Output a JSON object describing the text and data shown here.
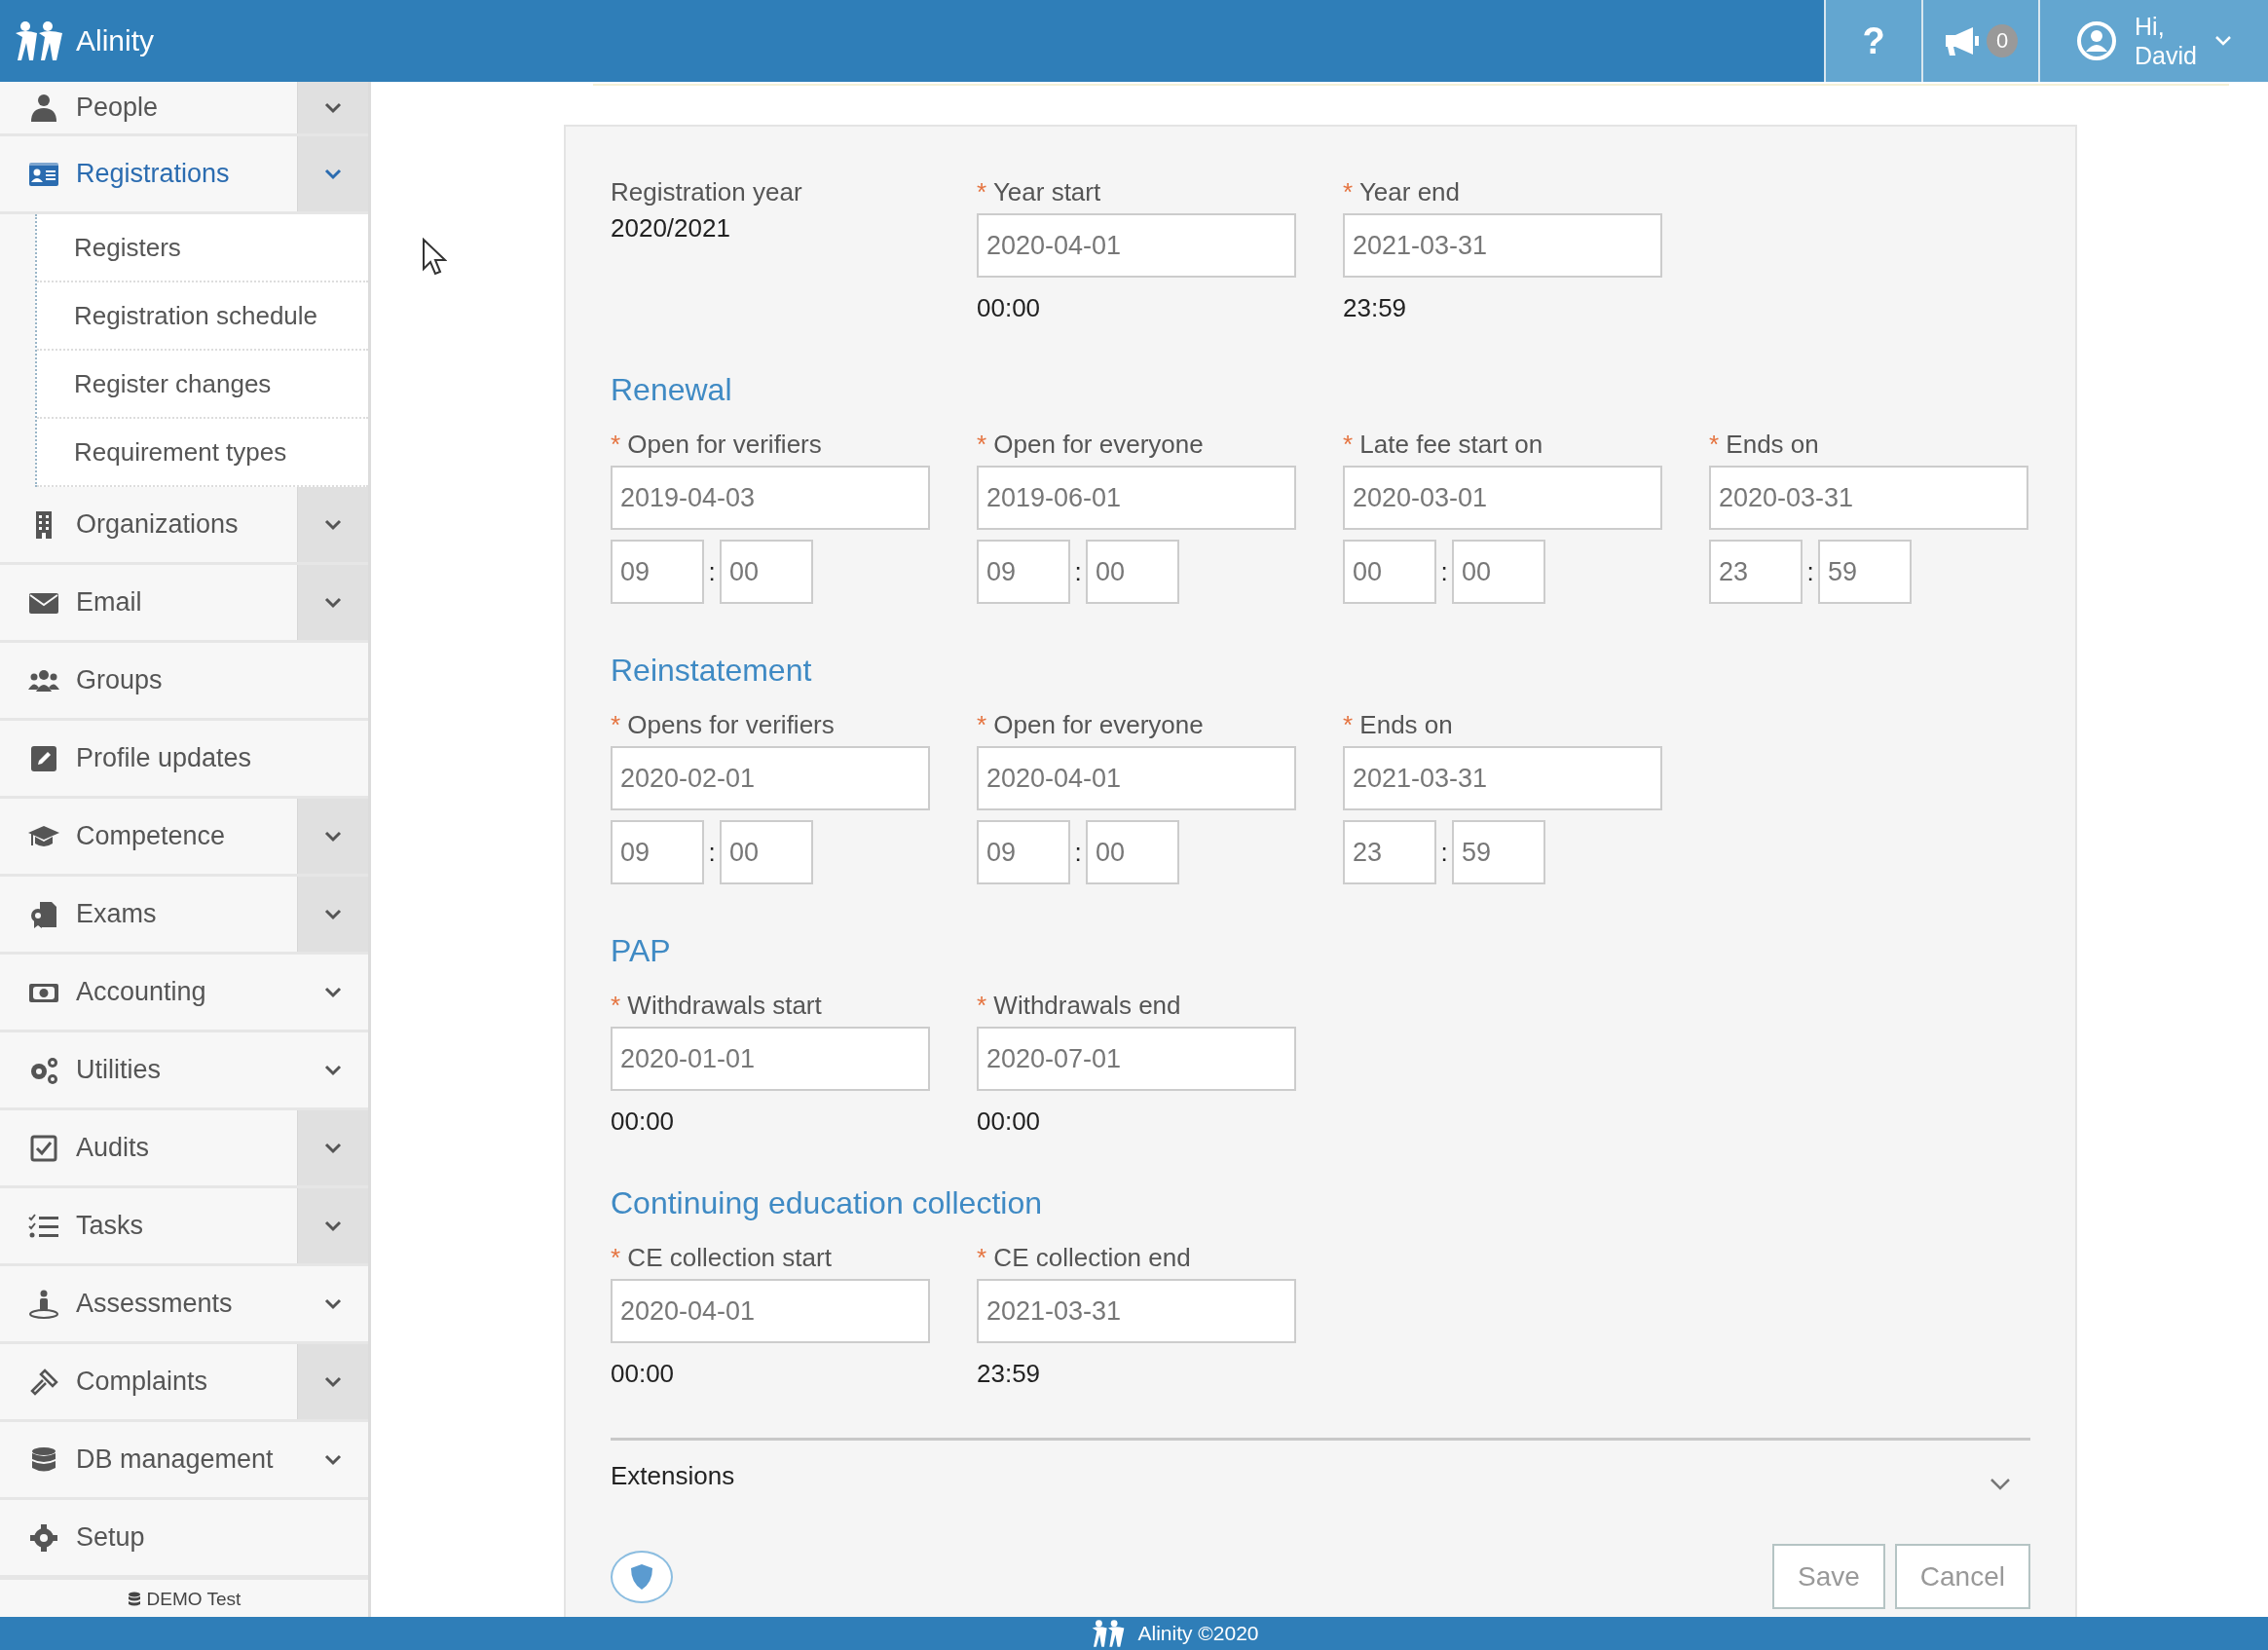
{
  "header": {
    "brand": "Alinity",
    "help": "?",
    "notifications": {
      "count": "0"
    },
    "user": {
      "greeting": "Hi,",
      "name": "David"
    }
  },
  "sidebar": {
    "items": [
      {
        "kind": "group",
        "label": "People",
        "selected": false,
        "split": true
      },
      {
        "kind": "group",
        "label": "Registrations",
        "selected": true,
        "split": true,
        "children": [
          {
            "label": "Registers"
          },
          {
            "label": "Registration schedule"
          },
          {
            "label": "Register changes"
          },
          {
            "label": "Requirement types"
          }
        ]
      },
      {
        "kind": "group",
        "label": "Organizations",
        "selected": false,
        "split": true
      },
      {
        "kind": "group",
        "label": "Email",
        "selected": false,
        "split": true
      },
      {
        "kind": "link",
        "label": "Groups",
        "selected": false
      },
      {
        "kind": "link",
        "label": "Profile updates",
        "selected": false
      },
      {
        "kind": "group",
        "label": "Competence",
        "selected": false,
        "split": true
      },
      {
        "kind": "group",
        "label": "Exams",
        "selected": false,
        "split": true
      },
      {
        "kind": "group",
        "label": "Accounting",
        "selected": false,
        "split": false
      },
      {
        "kind": "group",
        "label": "Utilities",
        "selected": false,
        "split": false
      },
      {
        "kind": "group",
        "label": "Audits",
        "selected": false,
        "split": true
      },
      {
        "kind": "group",
        "label": "Tasks",
        "selected": false,
        "split": true
      },
      {
        "kind": "group",
        "label": "Assessments",
        "selected": false,
        "split": false
      },
      {
        "kind": "group",
        "label": "Complaints",
        "selected": false,
        "split": true
      },
      {
        "kind": "group",
        "label": "DB management",
        "selected": false,
        "split": false
      },
      {
        "kind": "link",
        "label": "Setup",
        "selected": false
      }
    ],
    "environment": "DEMO Test"
  },
  "form": {
    "sections": [
      {
        "fields": [
          {
            "kind": "static",
            "label": "Registration year",
            "value": "2020/2021"
          },
          {
            "kind": "date-time-text",
            "required_mark": "*",
            "label": "Year start",
            "value": "2020-04-01",
            "time": "00:00"
          },
          {
            "kind": "date-time-text",
            "required_mark": "*",
            "label": "Year end",
            "value": "2021-03-31",
            "time": "23:59"
          }
        ]
      },
      {
        "title": "Renewal",
        "fields": [
          {
            "kind": "date-time-fields",
            "required_mark": "*",
            "label": "Open for verifiers",
            "value": "2019-04-03",
            "hour": "09",
            "separator": ":",
            "minute": "00"
          },
          {
            "kind": "date-time-fields",
            "required_mark": "*",
            "label": "Open for everyone",
            "value": "2019-06-01",
            "hour": "09",
            "separator": ":",
            "minute": "00"
          },
          {
            "kind": "date-time-fields",
            "required_mark": "*",
            "label": "Late fee start on",
            "value": "2020-03-01",
            "hour": "00",
            "separator": ":",
            "minute": "00"
          },
          {
            "kind": "date-time-fields",
            "required_mark": "*",
            "label": "Ends on",
            "value": "2020-03-31",
            "hour": "23",
            "separator": ":",
            "minute": "59"
          }
        ]
      },
      {
        "title": "Reinstatement",
        "fields": [
          {
            "kind": "date-time-fields",
            "required_mark": "*",
            "label": "Opens for verifiers",
            "value": "2020-02-01",
            "hour": "09",
            "separator": ":",
            "minute": "00"
          },
          {
            "kind": "date-time-fields",
            "required_mark": "*",
            "label": "Open for everyone",
            "value": "2020-04-01",
            "hour": "09",
            "separator": ":",
            "minute": "00"
          },
          {
            "kind": "date-time-fields",
            "required_mark": "*",
            "label": "Ends on",
            "value": "2021-03-31",
            "hour": "23",
            "separator": ":",
            "minute": "59"
          }
        ]
      },
      {
        "title": "PAP",
        "fields": [
          {
            "kind": "date-time-text",
            "required_mark": "*",
            "label": "Withdrawals start",
            "value": "2020-01-01",
            "time": "00:00"
          },
          {
            "kind": "date-time-text",
            "required_mark": "*",
            "label": "Withdrawals end",
            "value": "2020-07-01",
            "time": "00:00"
          }
        ]
      },
      {
        "title": "Continuing education collection",
        "fields": [
          {
            "kind": "date-time-text",
            "required_mark": "*",
            "label": "CE collection start",
            "value": "2020-04-01",
            "time": "00:00"
          },
          {
            "kind": "date-time-text",
            "required_mark": "*",
            "label": "CE collection end",
            "value": "2021-03-31",
            "time": "23:59"
          }
        ]
      }
    ],
    "extensions": {
      "label": "Extensions",
      "expanded": false
    },
    "buttons": [
      "Save",
      "Cancel"
    ]
  },
  "footer": {
    "text": "Alinity ©2020"
  }
}
